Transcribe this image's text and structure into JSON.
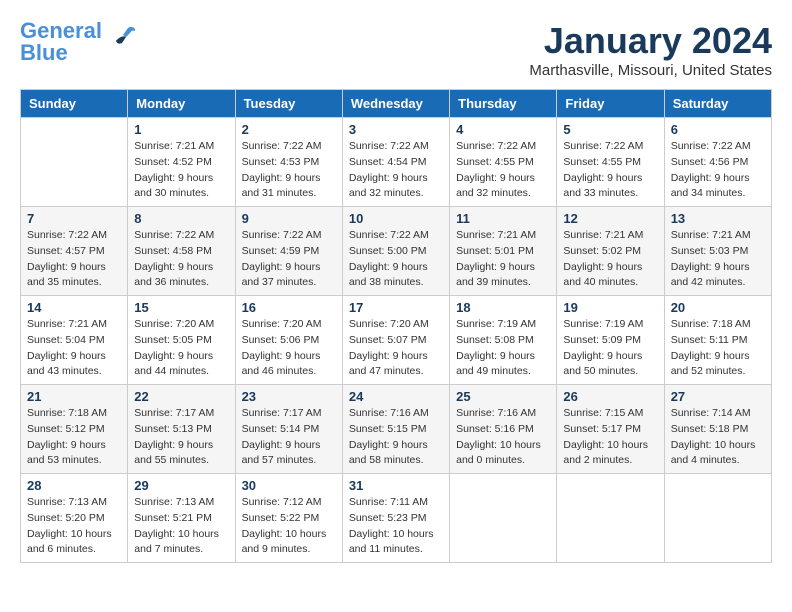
{
  "logo": {
    "line1": "General",
    "line2": "Blue"
  },
  "title": "January 2024",
  "subtitle": "Marthasville, Missouri, United States",
  "days_of_week": [
    "Sunday",
    "Monday",
    "Tuesday",
    "Wednesday",
    "Thursday",
    "Friday",
    "Saturday"
  ],
  "weeks": [
    [
      {
        "day": "",
        "info": ""
      },
      {
        "day": "1",
        "info": "Sunrise: 7:21 AM\nSunset: 4:52 PM\nDaylight: 9 hours\nand 30 minutes."
      },
      {
        "day": "2",
        "info": "Sunrise: 7:22 AM\nSunset: 4:53 PM\nDaylight: 9 hours\nand 31 minutes."
      },
      {
        "day": "3",
        "info": "Sunrise: 7:22 AM\nSunset: 4:54 PM\nDaylight: 9 hours\nand 32 minutes."
      },
      {
        "day": "4",
        "info": "Sunrise: 7:22 AM\nSunset: 4:55 PM\nDaylight: 9 hours\nand 32 minutes."
      },
      {
        "day": "5",
        "info": "Sunrise: 7:22 AM\nSunset: 4:55 PM\nDaylight: 9 hours\nand 33 minutes."
      },
      {
        "day": "6",
        "info": "Sunrise: 7:22 AM\nSunset: 4:56 PM\nDaylight: 9 hours\nand 34 minutes."
      }
    ],
    [
      {
        "day": "7",
        "info": "Sunrise: 7:22 AM\nSunset: 4:57 PM\nDaylight: 9 hours\nand 35 minutes."
      },
      {
        "day": "8",
        "info": "Sunrise: 7:22 AM\nSunset: 4:58 PM\nDaylight: 9 hours\nand 36 minutes."
      },
      {
        "day": "9",
        "info": "Sunrise: 7:22 AM\nSunset: 4:59 PM\nDaylight: 9 hours\nand 37 minutes."
      },
      {
        "day": "10",
        "info": "Sunrise: 7:22 AM\nSunset: 5:00 PM\nDaylight: 9 hours\nand 38 minutes."
      },
      {
        "day": "11",
        "info": "Sunrise: 7:21 AM\nSunset: 5:01 PM\nDaylight: 9 hours\nand 39 minutes."
      },
      {
        "day": "12",
        "info": "Sunrise: 7:21 AM\nSunset: 5:02 PM\nDaylight: 9 hours\nand 40 minutes."
      },
      {
        "day": "13",
        "info": "Sunrise: 7:21 AM\nSunset: 5:03 PM\nDaylight: 9 hours\nand 42 minutes."
      }
    ],
    [
      {
        "day": "14",
        "info": "Sunrise: 7:21 AM\nSunset: 5:04 PM\nDaylight: 9 hours\nand 43 minutes."
      },
      {
        "day": "15",
        "info": "Sunrise: 7:20 AM\nSunset: 5:05 PM\nDaylight: 9 hours\nand 44 minutes."
      },
      {
        "day": "16",
        "info": "Sunrise: 7:20 AM\nSunset: 5:06 PM\nDaylight: 9 hours\nand 46 minutes."
      },
      {
        "day": "17",
        "info": "Sunrise: 7:20 AM\nSunset: 5:07 PM\nDaylight: 9 hours\nand 47 minutes."
      },
      {
        "day": "18",
        "info": "Sunrise: 7:19 AM\nSunset: 5:08 PM\nDaylight: 9 hours\nand 49 minutes."
      },
      {
        "day": "19",
        "info": "Sunrise: 7:19 AM\nSunset: 5:09 PM\nDaylight: 9 hours\nand 50 minutes."
      },
      {
        "day": "20",
        "info": "Sunrise: 7:18 AM\nSunset: 5:11 PM\nDaylight: 9 hours\nand 52 minutes."
      }
    ],
    [
      {
        "day": "21",
        "info": "Sunrise: 7:18 AM\nSunset: 5:12 PM\nDaylight: 9 hours\nand 53 minutes."
      },
      {
        "day": "22",
        "info": "Sunrise: 7:17 AM\nSunset: 5:13 PM\nDaylight: 9 hours\nand 55 minutes."
      },
      {
        "day": "23",
        "info": "Sunrise: 7:17 AM\nSunset: 5:14 PM\nDaylight: 9 hours\nand 57 minutes."
      },
      {
        "day": "24",
        "info": "Sunrise: 7:16 AM\nSunset: 5:15 PM\nDaylight: 9 hours\nand 58 minutes."
      },
      {
        "day": "25",
        "info": "Sunrise: 7:16 AM\nSunset: 5:16 PM\nDaylight: 10 hours\nand 0 minutes."
      },
      {
        "day": "26",
        "info": "Sunrise: 7:15 AM\nSunset: 5:17 PM\nDaylight: 10 hours\nand 2 minutes."
      },
      {
        "day": "27",
        "info": "Sunrise: 7:14 AM\nSunset: 5:18 PM\nDaylight: 10 hours\nand 4 minutes."
      }
    ],
    [
      {
        "day": "28",
        "info": "Sunrise: 7:13 AM\nSunset: 5:20 PM\nDaylight: 10 hours\nand 6 minutes."
      },
      {
        "day": "29",
        "info": "Sunrise: 7:13 AM\nSunset: 5:21 PM\nDaylight: 10 hours\nand 7 minutes."
      },
      {
        "day": "30",
        "info": "Sunrise: 7:12 AM\nSunset: 5:22 PM\nDaylight: 10 hours\nand 9 minutes."
      },
      {
        "day": "31",
        "info": "Sunrise: 7:11 AM\nSunset: 5:23 PM\nDaylight: 10 hours\nand 11 minutes."
      },
      {
        "day": "",
        "info": ""
      },
      {
        "day": "",
        "info": ""
      },
      {
        "day": "",
        "info": ""
      }
    ]
  ]
}
